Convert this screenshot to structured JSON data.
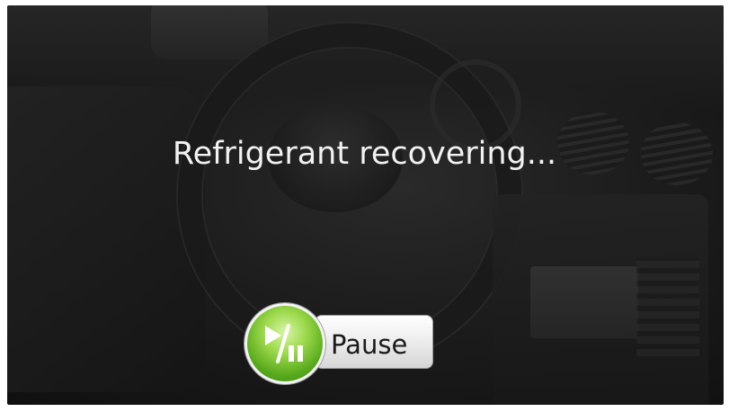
{
  "status": {
    "message": "Refrigerant recovering..."
  },
  "controls": {
    "pause_label": "Pause",
    "pause_icon": "play-pause-icon"
  },
  "colors": {
    "text": "#f2f2f2",
    "button_green": "#57a81c",
    "background": "#1c1c1c"
  }
}
